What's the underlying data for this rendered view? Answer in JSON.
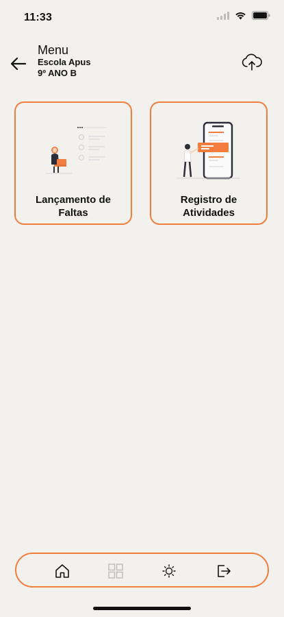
{
  "status_bar": {
    "time": "11:33"
  },
  "header": {
    "title": "Menu",
    "school": "Escola Apus",
    "class_name": "9º ANO B"
  },
  "cards": [
    {
      "line1": "Lançamento de",
      "line2": "Faltas"
    },
    {
      "line1": "Registro de",
      "line2": "Atividades"
    }
  ],
  "bottom_nav": [
    "home-icon",
    "grid-icon",
    "settings-icon",
    "logout-icon"
  ],
  "colors": {
    "accent": "#f27d3c",
    "background": "#f2f1ee",
    "text": "#111111"
  }
}
